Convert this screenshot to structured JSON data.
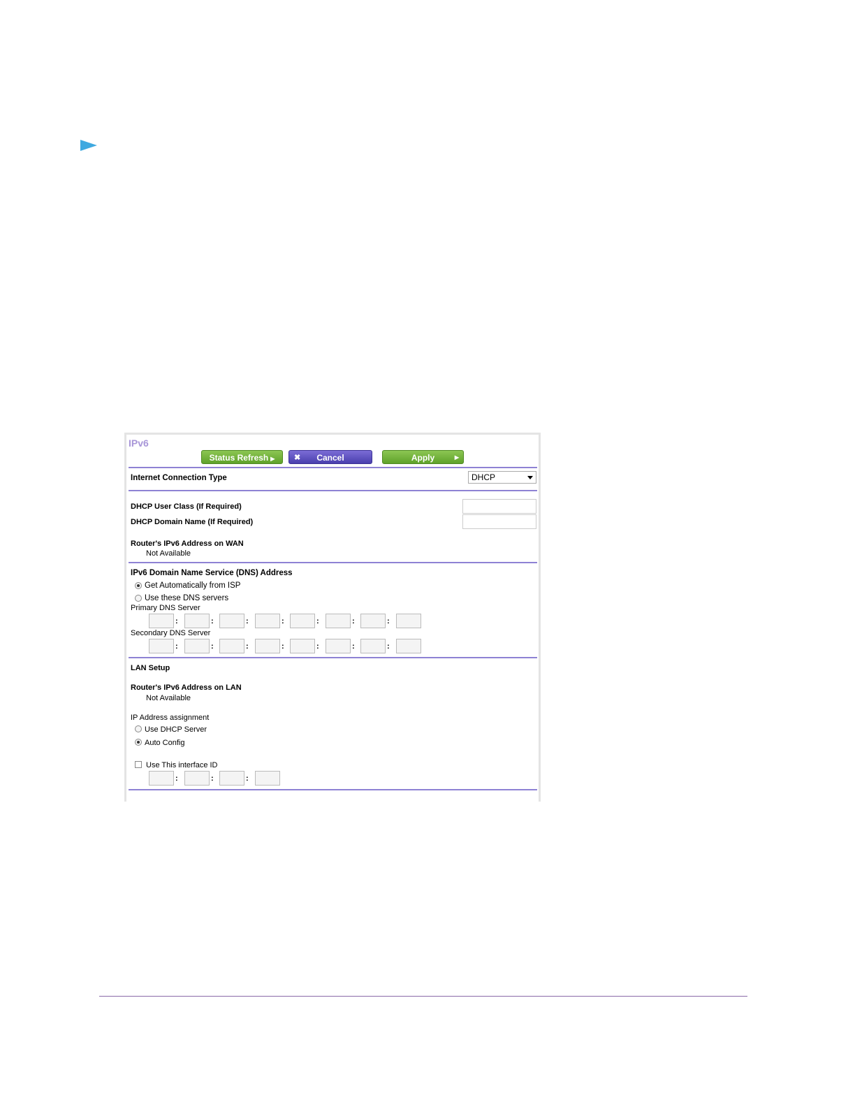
{
  "panel": {
    "title": "IPv6",
    "buttons": {
      "status_refresh": "Status Refresh",
      "cancel_icon": "x-icon",
      "cancel": "Cancel",
      "apply": "Apply"
    },
    "connection": {
      "label": "Internet Connection Type",
      "value": "DHCP"
    },
    "dhcp_user_class_label": "DHCP User Class (If Required)",
    "dhcp_user_class_value": "",
    "dhcp_domain_name_label": "DHCP Domain Name (If Required)",
    "dhcp_domain_name_value": "",
    "wan_address": {
      "label": "Router's IPv6 Address on WAN",
      "value": "Not Available"
    },
    "dns": {
      "heading": "IPv6 Domain Name Service (DNS) Address",
      "option_auto": "Get Automatically from ISP",
      "option_manual": "Use these DNS servers",
      "selected": "auto",
      "primary_label": "Primary DNS Server",
      "secondary_label": "Secondary DNS Server",
      "primary_segments": [
        "",
        "",
        "",
        "",
        "",
        "",
        "",
        ""
      ],
      "secondary_segments": [
        "",
        "",
        "",
        "",
        "",
        "",
        "",
        ""
      ]
    },
    "lan": {
      "heading": "LAN Setup",
      "address_label": "Router's IPv6 Address on LAN",
      "address_value": "Not Available",
      "assignment_label": "IP Address assignment",
      "option_dhcp": "Use DHCP Server",
      "option_auto": "Auto Config",
      "selected": "auto",
      "interface_id_label": "Use This interface ID",
      "interface_id_checked": false,
      "interface_id_segments": [
        "",
        "",
        "",
        ""
      ]
    }
  }
}
